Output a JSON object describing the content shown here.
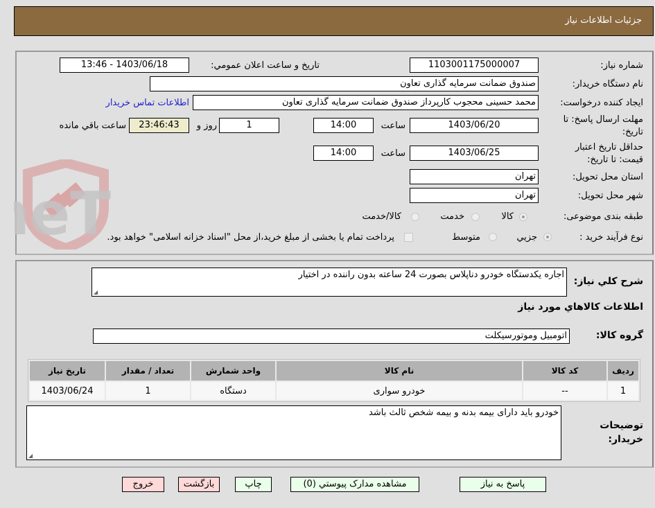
{
  "header": {
    "title": "جزئيات اطلاعات نياز"
  },
  "form": {
    "need_number_label": "شماره نياز:",
    "need_number": "1103001175000007",
    "announce_label": "تاريخ و ساعت اعلان عمومي:",
    "announce_value": "1403/06/18 - 13:46",
    "buyer_org_label": "نام دستگاه خريدار:",
    "buyer_org": "صندوق ضمانت سرمايه گذاری تعاون",
    "creator_label": "ايجاد کننده درخواست:",
    "creator": "محمد حسينی محجوب کارپرداز صندوق ضمانت سرمايه گذاری تعاون",
    "contact_link": "اطلاعات تماس خريدار",
    "reply_deadline_label_1": "مهلت ارسال پاسخ: تا",
    "reply_deadline_label_2": "تاريخ:",
    "reply_date": "1403/06/20",
    "hour_label": "ساعت",
    "reply_time": "14:00",
    "days_remaining": "1",
    "days_label": "روز و",
    "time_remaining": "23:46:43",
    "remaining_label": "ساعت باقي مانده",
    "validity_label_1": "حداقل تاريخ اعتبار",
    "validity_label_2": "قيمت: تا تاريخ:",
    "validity_date": "1403/06/25",
    "validity_time": "14:00",
    "province_label": "استان محل تحويل:",
    "province": "تهران",
    "city_label": "شهر محل تحويل:",
    "city": "تهران",
    "category_label": "طبقه بندی موضوعی:",
    "category_options": [
      "کالا",
      "خدمت",
      "کالا/خدمت"
    ],
    "category_selected": "کالا",
    "process_label": "نوع فرآيند خريد :",
    "process_options": [
      "جزيي",
      "متوسط"
    ],
    "process_selected": "جزيي",
    "treasury_note": "پرداخت تمام يا بخشی از مبلغ خريد،از محل \"اسناد خزانه اسلامی\" خواهد بود."
  },
  "details": {
    "description_label": "شرح کلي نياز:",
    "description": "اجاره يکدستگاه خودرو دناپلاس بصورت 24 ساعته بدون راننده در اختيار",
    "goods_info_title": "اطلاعات کالاهاي مورد نياز",
    "goods_group_label": "گروه کالا:",
    "goods_group": "اتومبيل وموتورسيکلت",
    "table": {
      "headers": [
        "رديف",
        "کد کالا",
        "نام کالا",
        "واحد شمارش",
        "تعداد / مقدار",
        "تاريخ نياز"
      ],
      "rows": [
        [
          "1",
          "--",
          "خودرو سواری",
          "دستگاه",
          "1",
          "1403/06/24"
        ]
      ]
    },
    "buyer_notes_label_1": "توضيحات",
    "buyer_notes_label_2": "خريدار:",
    "buyer_notes": "خودرو بايد دارای بيمه بدنه و بيمه شخص ثالث باشد"
  },
  "buttons": {
    "reply": "پاسخ به نياز",
    "attachments": "مشاهده مدارک پيوستي (0)",
    "print": "چاپ",
    "back": "بازگشت",
    "exit": "خروج"
  },
  "watermark": {
    "text": "AriaTender.neT"
  }
}
